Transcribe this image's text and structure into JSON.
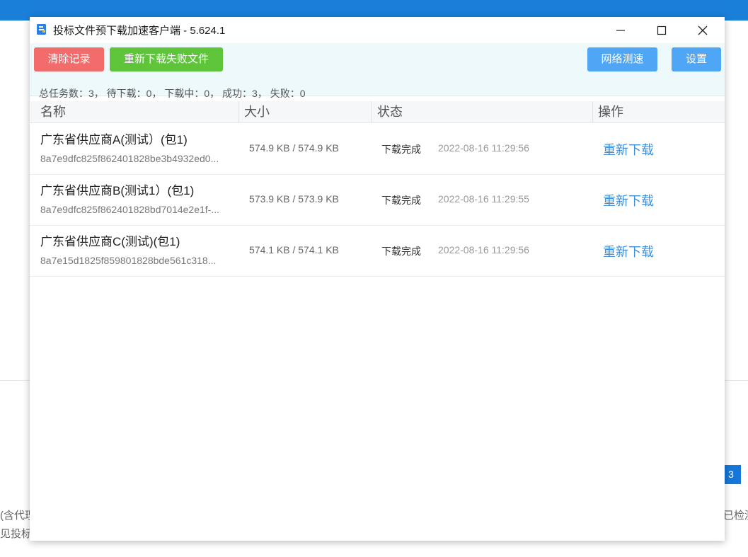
{
  "background": {
    "pager_active": "3",
    "left_text_1": "(含代理",
    "left_text_2": "见投标文",
    "right_text": "已检测"
  },
  "window": {
    "title": "投标文件预下载加速客户端 - 5.624.1",
    "controls": {
      "minimize_icon": "minimize-icon",
      "maximize_icon": "maximize-icon",
      "close_icon": "close-icon"
    }
  },
  "toolbar": {
    "clear_label": "清除记录",
    "redownload_failed_label": "重新下载失败文件",
    "speedtest_label": "网络测速",
    "settings_label": "设置"
  },
  "stats": "总任务数：3， 待下载：0， 下载中：0， 成功：3， 失败：0",
  "table": {
    "headers": [
      "名称",
      "大小",
      "状态",
      "操作"
    ],
    "rows": [
      {
        "name": "广东省供应商A(测试）(包1)",
        "id": "8a7e9dfc825f862401828be3b4932ed0...",
        "size": "574.9 KB / 574.9 KB",
        "status": "下载完成",
        "time": "2022-08-16 11:29:56",
        "action": "重新下载"
      },
      {
        "name": "广东省供应商B(测试1）(包1)",
        "id": "8a7e9dfc825f862401828bd7014e2e1f-...",
        "size": "573.9 KB / 573.9 KB",
        "status": "下载完成",
        "time": "2022-08-16 11:29:55",
        "action": "重新下载"
      },
      {
        "name": "广东省供应商C(测试)(包1)",
        "id": "8a7e15d1825f859801828bde561c318...",
        "size": "574.1 KB / 574.1 KB",
        "status": "下载完成",
        "time": "2022-08-16 11:29:56",
        "action": "重新下载"
      }
    ]
  },
  "colors": {
    "danger": "#f26c6c",
    "success": "#5ec43a",
    "primary": "#4ea6f5",
    "link": "#3d8fd8",
    "toolbar_bg": "#eef9fb"
  }
}
